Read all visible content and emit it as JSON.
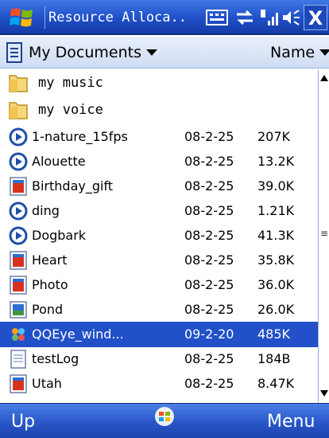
{
  "window": {
    "title": "Resource Alloca..",
    "close_label": "X"
  },
  "header": {
    "folder_label": "My Documents",
    "sort_label": "Name"
  },
  "folders": [
    {
      "name": "my music"
    },
    {
      "name": "my voice"
    }
  ],
  "files": [
    {
      "name": "1-nature_15fps",
      "date": "08-2-25",
      "size": "207K",
      "icon": "media-file-icon",
      "selected": false
    },
    {
      "name": "Alouette",
      "date": "08-2-25",
      "size": "13.2K",
      "icon": "media-file-icon",
      "selected": false
    },
    {
      "name": "Birthday_gift",
      "date": "08-2-25",
      "size": "39.0K",
      "icon": "image-file-icon",
      "selected": false
    },
    {
      "name": "ding",
      "date": "08-2-25",
      "size": "1.21K",
      "icon": "media-file-icon",
      "selected": false
    },
    {
      "name": "Dogbark",
      "date": "08-2-25",
      "size": "41.3K",
      "icon": "media-file-icon",
      "selected": false
    },
    {
      "name": "Heart",
      "date": "08-2-25",
      "size": "35.8K",
      "icon": "image-file-icon",
      "selected": false
    },
    {
      "name": "Photo",
      "date": "08-2-25",
      "size": "36.0K",
      "icon": "image-file-icon",
      "selected": false
    },
    {
      "name": "Pond",
      "date": "08-2-25",
      "size": "26.0K",
      "icon": "picture-file-icon",
      "selected": false
    },
    {
      "name": "QQEye_wind...",
      "date": "09-2-20",
      "size": "485K",
      "icon": "executable-file-icon",
      "selected": true
    },
    {
      "name": "testLog",
      "date": "08-2-25",
      "size": "184B",
      "icon": "text-file-icon",
      "selected": false
    },
    {
      "name": "Utah",
      "date": "08-2-25",
      "size": "8.47K",
      "icon": "image-file-icon",
      "selected": false
    }
  ],
  "softkeys": {
    "left": "Up",
    "right": "Menu"
  },
  "colors": {
    "title_bar": "#1f4fc7",
    "selection": "#2150c8",
    "header_bg": "#dbe5f6"
  }
}
